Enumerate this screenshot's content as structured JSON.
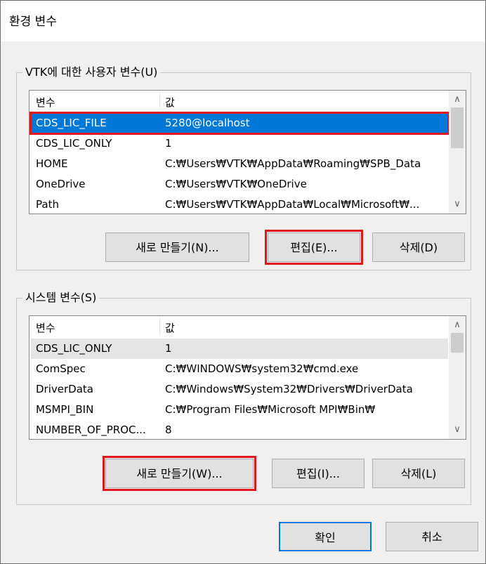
{
  "window": {
    "title": "환경 변수"
  },
  "user_vars": {
    "legend": "VTK에 대한 사용자 변수(U)",
    "headers": [
      "변수",
      "값"
    ],
    "rows": [
      {
        "name": "CDS_LIC_FILE",
        "value": "5280@localhost",
        "selected": true
      },
      {
        "name": "CDS_LIC_ONLY",
        "value": "1"
      },
      {
        "name": "HOME",
        "value": "C:₩Users₩VTK₩AppData₩Roaming₩SPB_Data"
      },
      {
        "name": "OneDrive",
        "value": "C:₩Users₩VTK₩OneDrive"
      },
      {
        "name": "Path",
        "value": "C:₩Users₩VTK₩AppData₩Local₩Microsoft₩..."
      }
    ],
    "buttons": {
      "new": "새로 만들기(N)...",
      "edit": "편집(E)...",
      "delete": "삭제(D)"
    }
  },
  "system_vars": {
    "legend": "시스템 변수(S)",
    "headers": [
      "변수",
      "값"
    ],
    "rows": [
      {
        "name": "CDS_LIC_ONLY",
        "value": "1",
        "highlighted": true
      },
      {
        "name": "ComSpec",
        "value": "C:₩WINDOWS₩system32₩cmd.exe"
      },
      {
        "name": "DriverData",
        "value": "C:₩Windows₩System32₩Drivers₩DriverData"
      },
      {
        "name": "MSMPI_BIN",
        "value": "C:₩Program Files₩Microsoft MPI₩Bin₩"
      },
      {
        "name": "NUMBER_OF_PROC...",
        "value": "8"
      }
    ],
    "buttons": {
      "new": "새로 만들기(W)...",
      "edit": "편집(I)...",
      "delete": "삭제(L)"
    }
  },
  "footer": {
    "ok": "확인",
    "cancel": "취소"
  },
  "icons": {
    "scroll_up": "chevron-up-icon",
    "scroll_down": "chevron-down-icon"
  },
  "colors": {
    "selection": "#0078d7",
    "annotation_red": "#e0171f"
  }
}
